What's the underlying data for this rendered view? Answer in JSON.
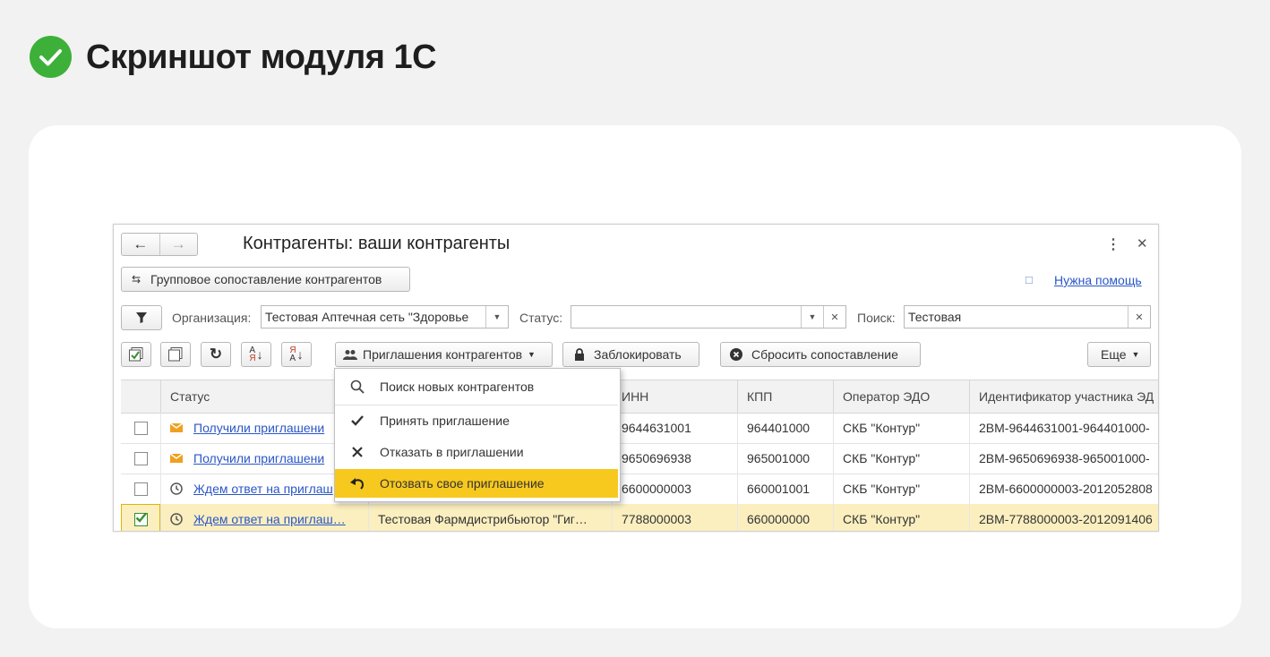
{
  "heading": {
    "text": "Скриншот модуля 1С",
    "icon": "check-circle-icon",
    "color": "#3db03a"
  },
  "window": {
    "title": "Контрагенты: ваши контрагенты",
    "group_match_label": "Групповое сопоставление контрагентов",
    "help_label": "Нужна помощь",
    "filters": {
      "org_label": "Организация:",
      "org_value": "Тестовая Аптечная сеть \"Здоровье",
      "status_label": "Статус:",
      "status_value": "",
      "search_label": "Поиск:",
      "search_value": "Тестовая"
    },
    "toolbar": {
      "invitations_label": "Приглашения контрагентов",
      "block_label": "Заблокировать",
      "reset_label": "Сбросить сопоставление",
      "more_label": "Еще"
    },
    "menu": {
      "items": [
        {
          "label": "Поиск новых контрагентов",
          "icon": "search-icon"
        },
        {
          "label": "Принять приглашение",
          "icon": "check-icon"
        },
        {
          "label": "Отказать в приглашении",
          "icon": "cross-icon"
        },
        {
          "label": "Отозвать свое приглашение",
          "icon": "undo-icon"
        }
      ]
    },
    "table": {
      "columns": [
        "Статус",
        "ИНН",
        "КПП",
        "Оператор ЭДО",
        "Идентификатор участника ЭД"
      ],
      "rows": [
        {
          "checked": false,
          "status_icon": "envelope-icon",
          "status": "Получили приглашени",
          "name": "",
          "inn": "9644631001",
          "kpp": "964401000",
          "operator": "СКБ \"Контур\"",
          "id": "2ВМ-9644631001-964401000-"
        },
        {
          "checked": false,
          "status_icon": "envelope-icon",
          "status": "Получили приглашени",
          "name": "",
          "inn": "9650696938",
          "kpp": "965001000",
          "operator": "СКБ \"Контур\"",
          "id": "2ВМ-9650696938-965001000-"
        },
        {
          "checked": false,
          "status_icon": "clock-icon",
          "status": "Ждем ответ на приглаш",
          "name": "",
          "inn": "6600000003",
          "kpp": "660001001",
          "operator": "СКБ \"Контур\"",
          "id": "2ВМ-6600000003-2012052808"
        },
        {
          "checked": true,
          "status_icon": "clock-icon",
          "status": "Ждем ответ на приглаш…",
          "name": "Тестовая Фармдистрибьютор \"Гиг…",
          "inn": "7788000003",
          "kpp": "660000000",
          "operator": "СКБ \"Контур\"",
          "id": "2ВМ-7788000003-2012091406"
        }
      ]
    }
  }
}
